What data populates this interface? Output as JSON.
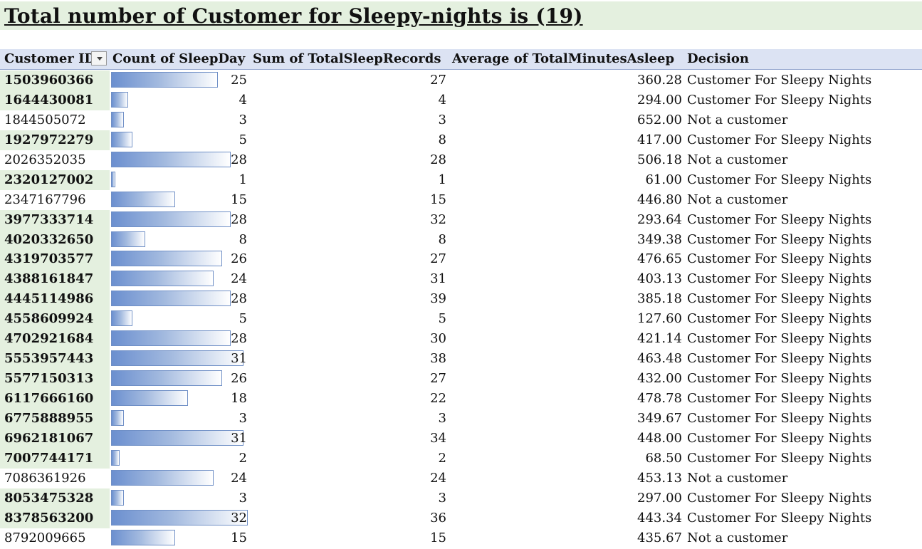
{
  "title": "Total number of Customer for Sleepy-nights is (19)",
  "columns": {
    "customer_id": "Customer ID",
    "count_sleepday": "Count of SleepDay",
    "sum_records": "Sum of TotalSleepRecords",
    "avg_minutes": "Average of TotalMinutesAsleep",
    "decision": "Decision"
  },
  "colors": {
    "customer_highlight": "#e4f0df",
    "header_bg": "#dce3f3",
    "databar": "#6b8fcf"
  },
  "icons": {
    "filter": "dropdown-arrow-icon"
  },
  "data_bar_max": 32,
  "rows": [
    {
      "id": "1503960366",
      "count": "25",
      "records": "27",
      "avg": "360.28",
      "decision": "Customer For Sleepy Nights",
      "customer": true
    },
    {
      "id": "1644430081",
      "count": "4",
      "records": "4",
      "avg": "294.00",
      "decision": "Customer For Sleepy Nights",
      "customer": true
    },
    {
      "id": "1844505072",
      "count": "3",
      "records": "3",
      "avg": "652.00",
      "decision": "Not a customer",
      "customer": false
    },
    {
      "id": "1927972279",
      "count": "5",
      "records": "8",
      "avg": "417.00",
      "decision": "Customer For Sleepy Nights",
      "customer": true
    },
    {
      "id": "2026352035",
      "count": "28",
      "records": "28",
      "avg": "506.18",
      "decision": "Not a customer",
      "customer": false
    },
    {
      "id": "2320127002",
      "count": "1",
      "records": "1",
      "avg": "61.00",
      "decision": "Customer For Sleepy Nights",
      "customer": true
    },
    {
      "id": "2347167796",
      "count": "15",
      "records": "15",
      "avg": "446.80",
      "decision": "Not a customer",
      "customer": false
    },
    {
      "id": "3977333714",
      "count": "28",
      "records": "32",
      "avg": "293.64",
      "decision": "Customer For Sleepy Nights",
      "customer": true
    },
    {
      "id": "4020332650",
      "count": "8",
      "records": "8",
      "avg": "349.38",
      "decision": "Customer For Sleepy Nights",
      "customer": true
    },
    {
      "id": "4319703577",
      "count": "26",
      "records": "27",
      "avg": "476.65",
      "decision": "Customer For Sleepy Nights",
      "customer": true
    },
    {
      "id": "4388161847",
      "count": "24",
      "records": "31",
      "avg": "403.13",
      "decision": "Customer For Sleepy Nights",
      "customer": true
    },
    {
      "id": "4445114986",
      "count": "28",
      "records": "39",
      "avg": "385.18",
      "decision": "Customer For Sleepy Nights",
      "customer": true
    },
    {
      "id": "4558609924",
      "count": "5",
      "records": "5",
      "avg": "127.60",
      "decision": "Customer For Sleepy Nights",
      "customer": true
    },
    {
      "id": "4702921684",
      "count": "28",
      "records": "30",
      "avg": "421.14",
      "decision": "Customer For Sleepy Nights",
      "customer": true
    },
    {
      "id": "5553957443",
      "count": "31",
      "records": "38",
      "avg": "463.48",
      "decision": "Customer For Sleepy Nights",
      "customer": true
    },
    {
      "id": "5577150313",
      "count": "26",
      "records": "27",
      "avg": "432.00",
      "decision": "Customer For Sleepy Nights",
      "customer": true
    },
    {
      "id": "6117666160",
      "count": "18",
      "records": "22",
      "avg": "478.78",
      "decision": "Customer For Sleepy Nights",
      "customer": true
    },
    {
      "id": "6775888955",
      "count": "3",
      "records": "3",
      "avg": "349.67",
      "decision": "Customer For Sleepy Nights",
      "customer": true
    },
    {
      "id": "6962181067",
      "count": "31",
      "records": "34",
      "avg": "448.00",
      "decision": "Customer For Sleepy Nights",
      "customer": true
    },
    {
      "id": "7007744171",
      "count": "2",
      "records": "2",
      "avg": "68.50",
      "decision": "Customer For Sleepy Nights",
      "customer": true
    },
    {
      "id": "7086361926",
      "count": "24",
      "records": "24",
      "avg": "453.13",
      "decision": "Not a customer",
      "customer": false
    },
    {
      "id": "8053475328",
      "count": "3",
      "records": "3",
      "avg": "297.00",
      "decision": "Customer For Sleepy Nights",
      "customer": true
    },
    {
      "id": "8378563200",
      "count": "32",
      "records": "36",
      "avg": "443.34",
      "decision": "Customer For Sleepy Nights",
      "customer": true
    },
    {
      "id": "8792009665",
      "count": "15",
      "records": "15",
      "avg": "435.67",
      "decision": "Not a customer",
      "customer": false
    }
  ]
}
